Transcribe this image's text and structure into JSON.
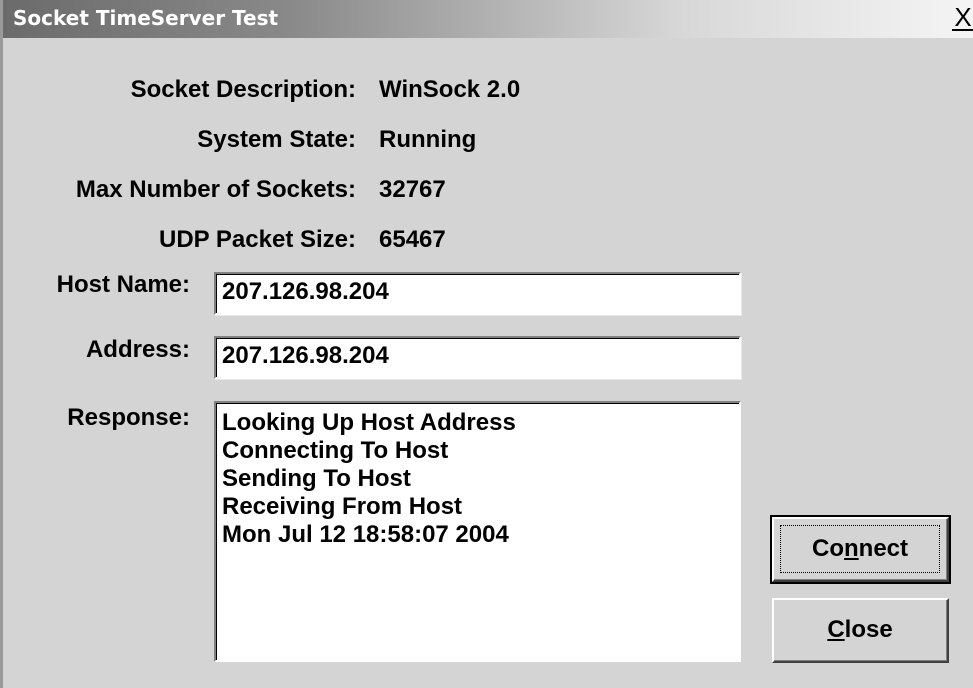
{
  "window": {
    "title": "Socket TimeServer Test",
    "close_glyph": "X"
  },
  "info": [
    {
      "label": "Socket Description:",
      "value": "WinSock 2.0"
    },
    {
      "label": "System State:",
      "value": "Running"
    },
    {
      "label": "Max Number of Sockets:",
      "value": "32767"
    },
    {
      "label": "UDP Packet Size:",
      "value": "65467"
    }
  ],
  "host": {
    "label": "Host Name:",
    "value": "207.126.98.204"
  },
  "address": {
    "label": "Address:",
    "value": "207.126.98.204"
  },
  "response": {
    "label": "Response:",
    "lines": [
      "Looking Up Host Address",
      "Connecting To Host",
      "Sending To Host",
      "Receiving From Host",
      "Mon Jul 12 18:58:07 2004"
    ]
  },
  "buttons": {
    "connect": {
      "pre": "Co",
      "mnemonic": "n",
      "post": "nect"
    },
    "close": {
      "pre": "",
      "mnemonic": "C",
      "post": "lose"
    }
  }
}
